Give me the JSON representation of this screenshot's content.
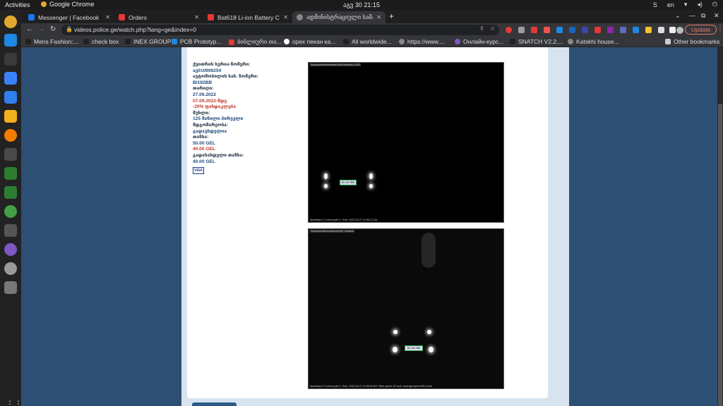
{
  "system": {
    "activities": "Activities",
    "app_name": "Google Chrome",
    "clock": "აგვ 30  21:15",
    "language": "en"
  },
  "tabs": [
    {
      "title": "Messenger | Facebook",
      "color": "#1877f2"
    },
    {
      "title": "Orders",
      "color": "#e53935"
    },
    {
      "title": "Bat618 Li-ion Battery Cha",
      "color": "#e53935"
    },
    {
      "title": "ადმინისტრაციული სამა...",
      "color": "#888888"
    }
  ],
  "toolbar": {
    "url": "videos.police.ge/watch.php?lang=ge&index=0",
    "update_label": "Update"
  },
  "bookmarks": [
    "Mens Fashion:...",
    "check box",
    "INEX GROUP",
    "PCB Prototyp...",
    "ბიბლიური თა...",
    "орех пекан ка...",
    "All worldwide...",
    "https://www....",
    "Онлайн-курс...",
    "SNATCH V2.2....",
    "Katskhi house..."
  ],
  "other_bookmarks": "Other bookmarks",
  "violation": {
    "receipt_label": "ქვითრის სერია-ნომერი:",
    "receipt_value": "აე010906254",
    "plate_label": "ავტომობილის სახ. ნომერი:",
    "plate_value": "BI192BB",
    "date_label": "თარიღი:",
    "date_value": "27.06.2022",
    "discount_date": "07.09.2022-მდე",
    "discount": "-20% ფასდაკლება",
    "article_label": "მუხლი:",
    "article_value": "125 მანილი პირველი",
    "status_label": "მდგომარეობა:",
    "status_value": "გადაუხდელია",
    "amount_label": "თანხა:",
    "amount_value": "50.00 GEL",
    "amount_discounted": "40.00 GEL",
    "to_pay_label": "გადასახდელი თანხა:",
    "to_pay_value": "40.00 GEL",
    "card_brand": "VISA"
  },
  "photos": [
    {
      "header": "PassportNumbersNearCam1Violation_VOD",
      "footer": "Speeding f1 Control point 1; Time: 2022-06-27 12:56:12.161",
      "plate": "BI 192 BB"
    },
    {
      "header": "PassportUBackupNumbersB_Violation",
      "footer": "Speeding f1 Control point 1; Time: 2022-06-27 12:56:09.637 *Max speed: 87 km/h, Average speed 86.4 km/h",
      "plate": "BI 192 BB"
    }
  ]
}
